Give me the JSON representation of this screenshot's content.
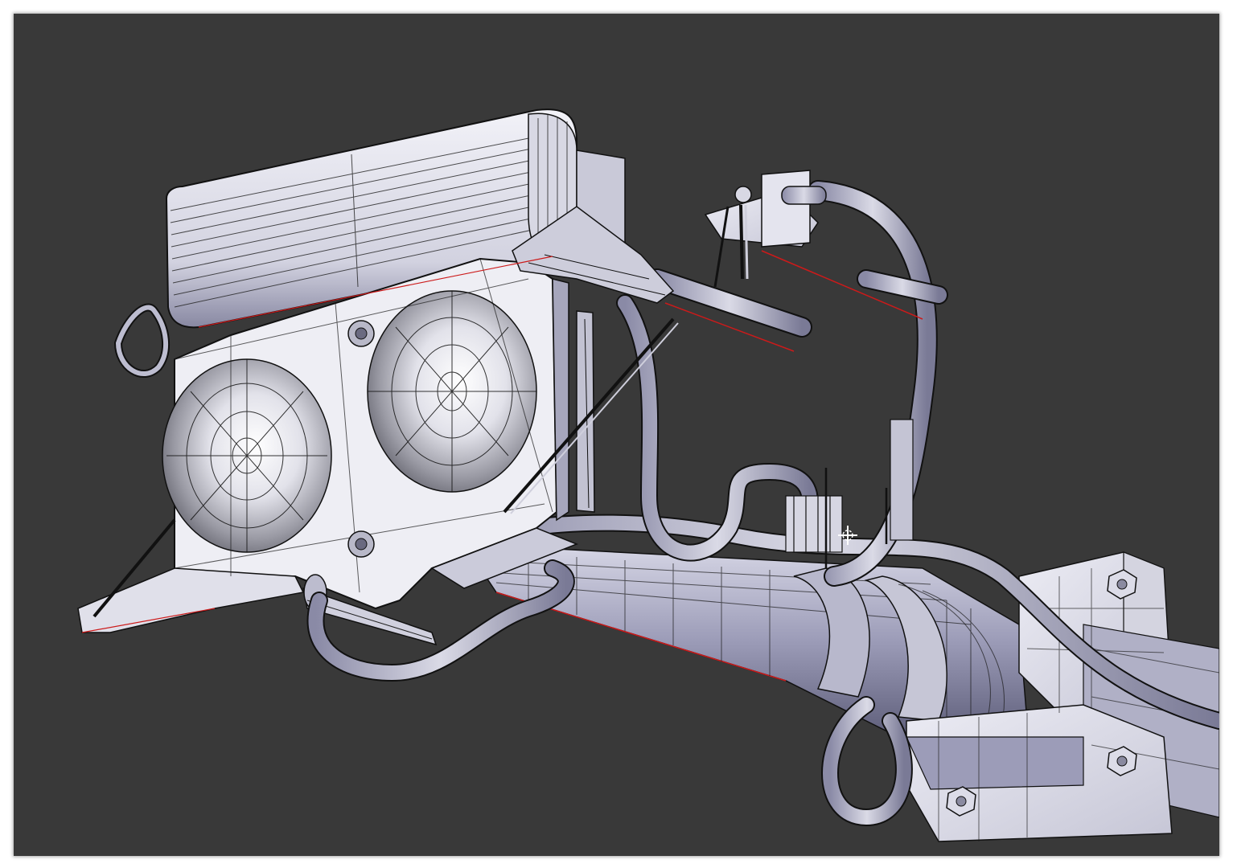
{
  "app": {
    "view": "3d-viewport",
    "shading": "solid-with-wireframe"
  },
  "colors": {
    "viewport_background": "#393939",
    "mesh_light": "#e6e6ee",
    "mesh_mid": "#a8a8c2",
    "mesh_dark": "#6e6e8a",
    "wire": "#111111",
    "edge_highlight": "#cc1a1a"
  },
  "icons": {
    "cursor": "3d-cursor-icon"
  }
}
